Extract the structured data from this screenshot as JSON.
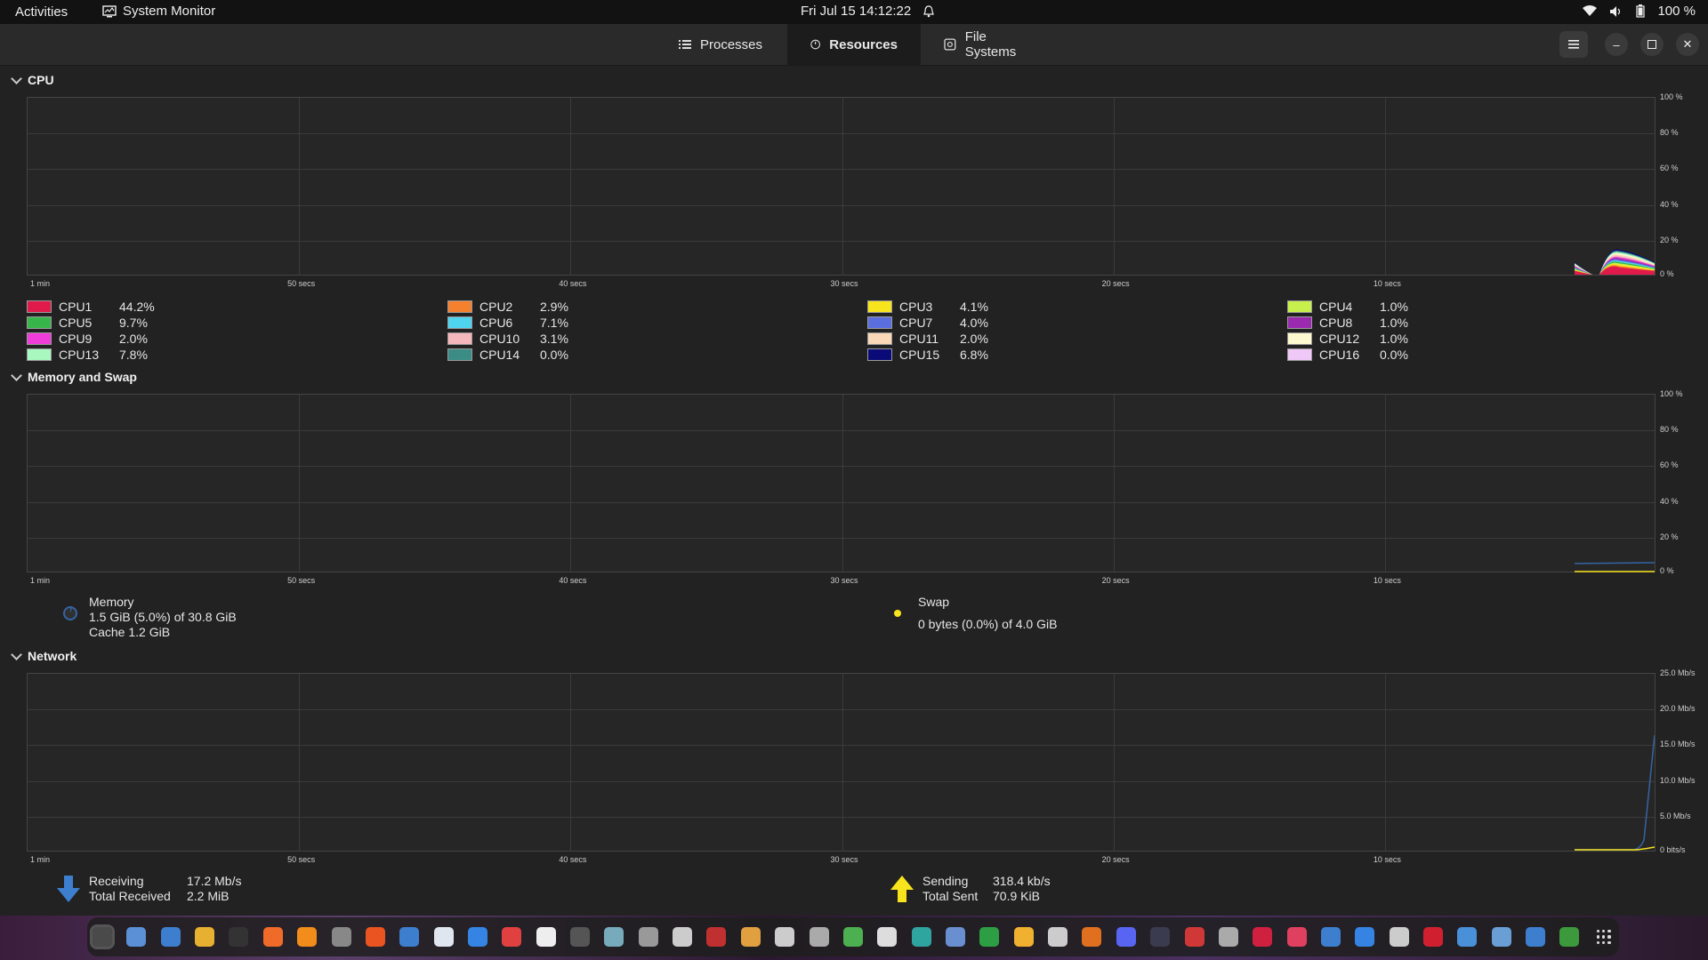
{
  "topbar": {
    "activities": "Activities",
    "app_name": "System Monitor",
    "datetime": "Fri Jul 15  14:12:22",
    "battery": "100 %"
  },
  "tabs": [
    {
      "label": "Processes",
      "icon": "list-icon"
    },
    {
      "label": "Resources",
      "icon": "gauge-icon",
      "active": true
    },
    {
      "label": "File Systems",
      "icon": "disk-icon"
    }
  ],
  "sections": {
    "cpu": "CPU",
    "memory": "Memory and Swap",
    "network": "Network"
  },
  "x_ticks": [
    "1 min",
    "50 secs",
    "40 secs",
    "30 secs",
    "20 secs",
    "10 secs"
  ],
  "pct_ticks": [
    "100 %",
    "80 %",
    "60 %",
    "40 %",
    "20 %",
    "0 %"
  ],
  "net_ticks": [
    "25.0 Mb/s",
    "20.0 Mb/s",
    "15.0 Mb/s",
    "10.0 Mb/s",
    "5.0 Mb/s",
    "0 bits/s"
  ],
  "cpus": [
    {
      "name": "CPU1",
      "value": "44.2%",
      "color": "#e01b4c"
    },
    {
      "name": "CPU2",
      "value": "2.9%",
      "color": "#f5802e"
    },
    {
      "name": "CPU3",
      "value": "4.1%",
      "color": "#f8e41c"
    },
    {
      "name": "CPU4",
      "value": "1.0%",
      "color": "#c8f04c"
    },
    {
      "name": "CPU5",
      "value": "9.7%",
      "color": "#38b54a"
    },
    {
      "name": "CPU6",
      "value": "7.1%",
      "color": "#4fd4f0"
    },
    {
      "name": "CPU7",
      "value": "4.0%",
      "color": "#5a6ee0"
    },
    {
      "name": "CPU8",
      "value": "1.0%",
      "color": "#9c2ab0"
    },
    {
      "name": "CPU9",
      "value": "2.0%",
      "color": "#f03cd8"
    },
    {
      "name": "CPU10",
      "value": "3.1%",
      "color": "#f4b8bc"
    },
    {
      "name": "CPU11",
      "value": "2.0%",
      "color": "#fad8b8"
    },
    {
      "name": "CPU12",
      "value": "1.0%",
      "color": "#fefad0"
    },
    {
      "name": "CPU13",
      "value": "7.8%",
      "color": "#a8f8c0"
    },
    {
      "name": "CPU14",
      "value": "0.0%",
      "color": "#3a8c84"
    },
    {
      "name": "CPU15",
      "value": "6.8%",
      "color": "#0a0a78"
    },
    {
      "name": "CPU16",
      "value": "0.0%",
      "color": "#f0c8f8"
    }
  ],
  "memory": {
    "label": "Memory",
    "usage": "1.5 GiB (5.0%) of 30.8 GiB",
    "cache": "Cache 1.2 GiB",
    "color": "#3465a4"
  },
  "swap": {
    "label": "Swap",
    "usage": "0 bytes (0.0%) of 4.0 GiB",
    "color": "#f8e41c"
  },
  "network": {
    "receiving_label": "Receiving",
    "receiving_value": "17.2 Mb/s",
    "total_received_label": "Total Received",
    "total_received_value": "2.2 MiB",
    "sending_label": "Sending",
    "sending_value": "318.4 kb/s",
    "total_sent_label": "Total Sent",
    "total_sent_value": "70.9 KiB",
    "receive_color": "#3465a4",
    "send_color": "#f8e41c"
  },
  "dock_icons": [
    "system-monitor-icon",
    "files-icon",
    "text-editor-icon",
    "archive-icon",
    "terminal-icon",
    "firefox-icon",
    "vlc-icon",
    "settings-icon",
    "app-store-icon",
    "notes-icon",
    "calendar-icon",
    "help-icon",
    "monitor-icon",
    "document-icon",
    "tool-icon",
    "cube-icon",
    "circle-icon",
    "arrow-icon",
    "java-icon",
    "game-icon",
    "clipboard-icon",
    "search-icon",
    "chrome-icon",
    "books-icon",
    "image-icon",
    "camera-icon",
    "spreadsheet-icon",
    "folder-icon",
    "archive2-icon",
    "presentation-icon",
    "discord-icon",
    "steam-icon",
    "pdf-icon",
    "percent-icon",
    "record-icon",
    "gift-icon",
    "cloud-icon",
    "window-icon",
    "disk-icon",
    "bookmark-icon",
    "dashboard-icon",
    "calculator-icon",
    "code-icon",
    "trash-icon",
    "app-grid-icon"
  ]
}
